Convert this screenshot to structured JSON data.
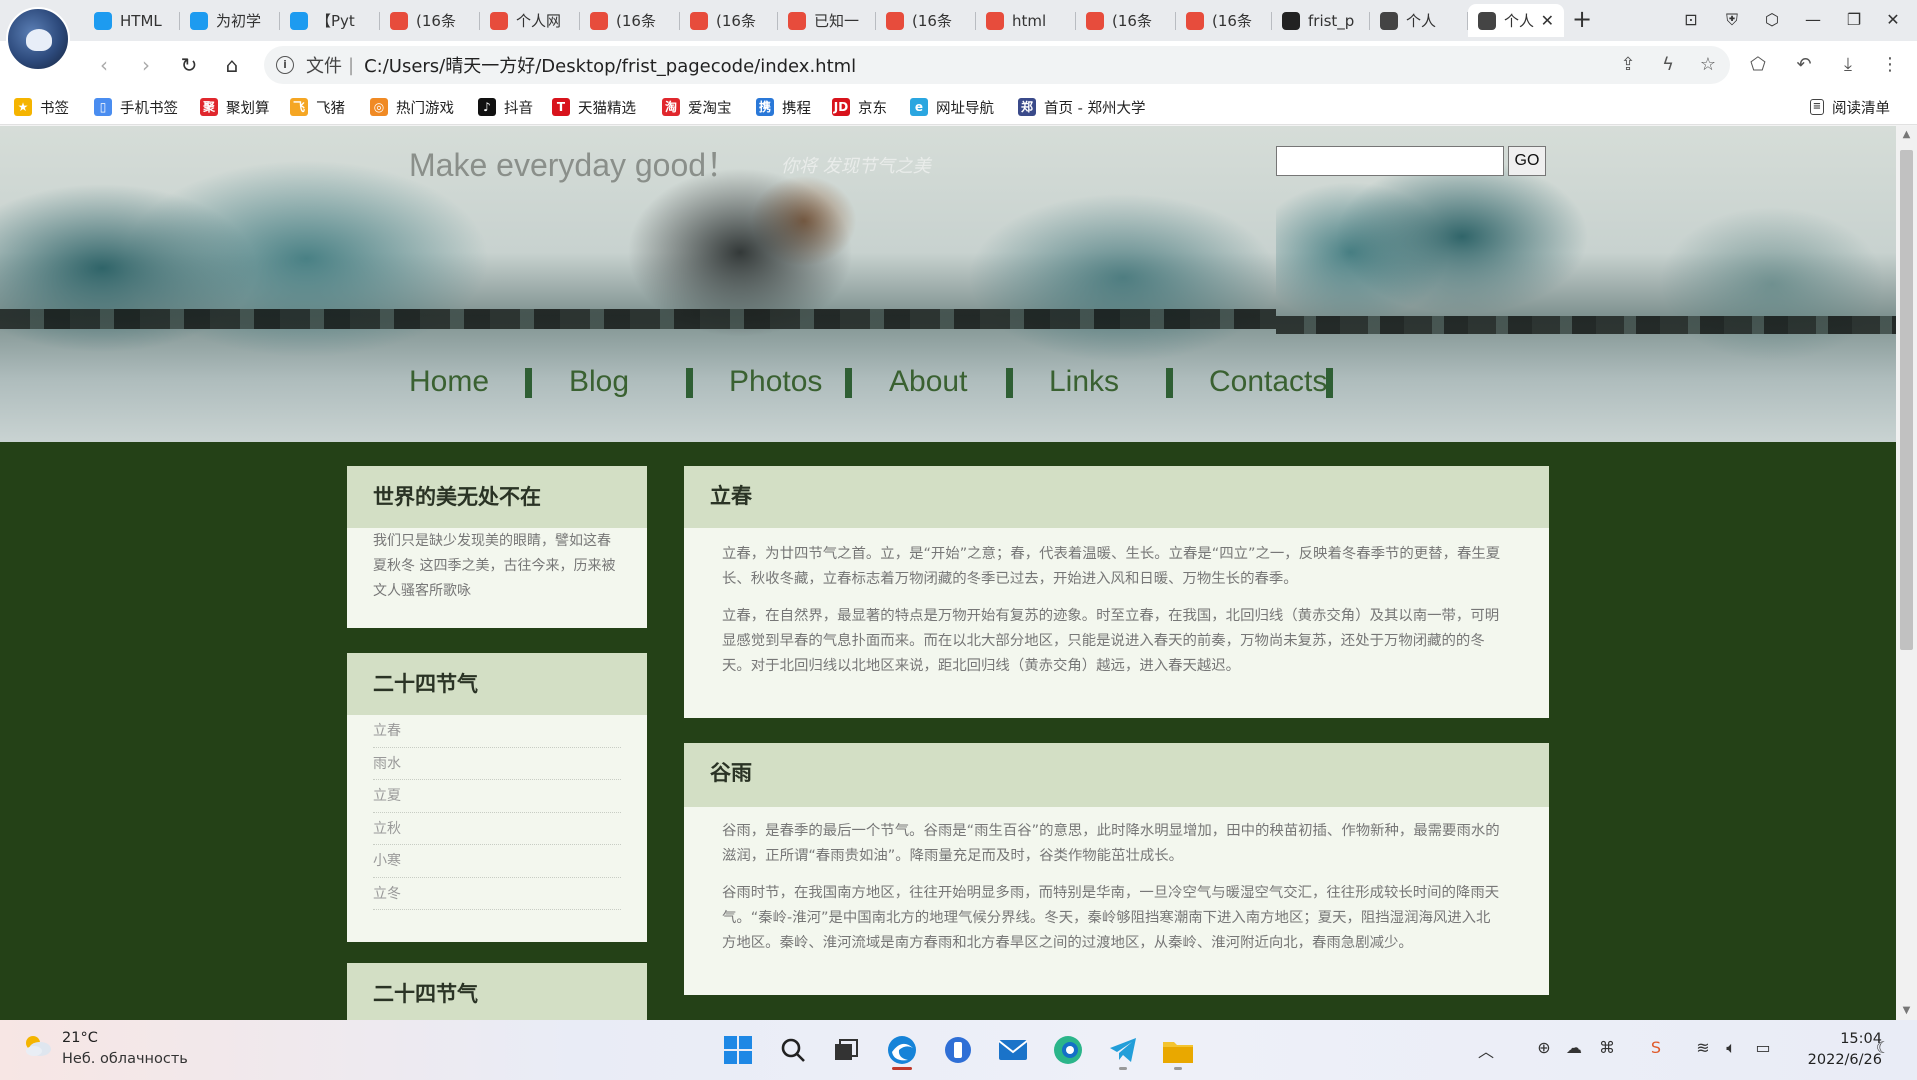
{
  "browser": {
    "tabs": [
      {
        "label": "HTML",
        "color": "#1d9bf0",
        "glyph": "tv"
      },
      {
        "label": "为初学",
        "color": "#1d9bf0",
        "glyph": "tv"
      },
      {
        "label": "【Pyt",
        "color": "#1d9bf0",
        "glyph": "tv"
      },
      {
        "label": "(16条",
        "color": "#e74c3c",
        "glyph": "C"
      },
      {
        "label": "个人网",
        "color": "#e74c3c",
        "glyph": "C"
      },
      {
        "label": "(16条",
        "color": "#e74c3c",
        "glyph": "C"
      },
      {
        "label": "(16条",
        "color": "#e74c3c",
        "glyph": "C"
      },
      {
        "label": "已知一",
        "color": "#e74c3c",
        "glyph": "C"
      },
      {
        "label": "(16条",
        "color": "#e74c3c",
        "glyph": "C"
      },
      {
        "label": "html",
        "color": "#e74c3c",
        "glyph": "C"
      },
      {
        "label": "(16条",
        "color": "#e74c3c",
        "glyph": "C"
      },
      {
        "label": "(16条",
        "color": "#e74c3c",
        "glyph": "C"
      },
      {
        "label": "frist_p",
        "color": "#222222",
        "glyph": "gh"
      },
      {
        "label": "个人",
        "color": "#444444",
        "glyph": "e"
      },
      {
        "label": "个人",
        "color": "#444444",
        "glyph": "e"
      }
    ],
    "url_scheme": "文件",
    "url": "C:/Users/晴天一方好/Desktop/frist_pagecode/index.html",
    "bookmarks": [
      {
        "label": "书签",
        "color": "#f5b400",
        "glyph": "★"
      },
      {
        "label": "手机书签",
        "color": "#4a8df0",
        "glyph": "▯"
      },
      {
        "label": "聚划算",
        "color": "#e0272d",
        "glyph": "聚"
      },
      {
        "label": "飞猪",
        "color": "#f5a623",
        "glyph": "飞"
      },
      {
        "label": "热门游戏",
        "color": "#f08a24",
        "glyph": "◎"
      },
      {
        "label": "抖音",
        "color": "#111111",
        "glyph": "♪"
      },
      {
        "label": "天猫精选",
        "color": "#d8131c",
        "glyph": "T"
      },
      {
        "label": "爱淘宝",
        "color": "#e0272d",
        "glyph": "淘"
      },
      {
        "label": "携程",
        "color": "#2a78d8",
        "glyph": "携"
      },
      {
        "label": "京东",
        "color": "#d8131c",
        "glyph": "JD"
      },
      {
        "label": "网址导航",
        "color": "#2aa6e0",
        "glyph": "e"
      },
      {
        "label": "首页 - 郑州大学",
        "color": "#3a4a8a",
        "glyph": "郑"
      }
    ],
    "reading_list": "阅读清单"
  },
  "page": {
    "slogan": "Make everyday good！",
    "subslogan": "你将 发现节气之美",
    "search_button": "GO",
    "nav": [
      "Home",
      "Blog",
      "Photos",
      "About",
      "Links",
      "Contacts"
    ],
    "sidebar": {
      "box1_title": "世界的美无处不在",
      "box1_text": "我们只是缺少发现美的眼睛，譬如这春夏秋冬 这四季之美，古往今来，历来被文人骚客所歌咏",
      "box2_title": "二十四节气",
      "box2_items": [
        "立春",
        "雨水",
        "立夏",
        "立秋",
        "小寒",
        "立冬"
      ],
      "box3_title": "二十四节气"
    },
    "articles": [
      {
        "title": "立春",
        "paragraphs": [
          "立春，为廿四节气之首。立，是“开始”之意；春，代表着温暖、生长。立春是“四立”之一，反映着冬春季节的更替，春生夏长、秋收冬藏，立春标志着万物闭藏的冬季已过去，开始进入风和日暖、万物生长的春季。",
          "立春，在自然界，最显著的特点是万物开始有复苏的迹象。时至立春，在我国，北回归线（黄赤交角）及其以南一带，可明显感觉到早春的气息扑面而来。而在以北大部分地区，只能是说进入春天的前奏，万物尚未复苏，还处于万物闭藏的的冬天。对于北回归线以北地区来说，距北回归线（黄赤交角）越远，进入春天越迟。"
        ]
      },
      {
        "title": "谷雨",
        "paragraphs": [
          "谷雨，是春季的最后一个节气。谷雨是“雨生百谷”的意思，此时降水明显增加，田中的秧苗初插、作物新种，最需要雨水的滋润，正所谓“春雨贵如油”。降雨量充足而及时，谷类作物能茁壮成长。",
          "谷雨时节，在我国南方地区，往往开始明显多雨，而特别是华南，一旦冷空气与暖湿空气交汇，往往形成较长时间的降雨天气。“秦岭-淮河”是中国南北方的地理气候分界线。冬天，秦岭够阻挡寒潮南下进入南方地区；夏天，阻挡湿润海风进入北方地区。秦岭、淮河流域是南方春雨和北方春旱区之间的过渡地区，从秦岭、淮河附近向北，春雨急剧减少。"
        ]
      }
    ]
  },
  "taskbar": {
    "weather_temp": "21°C",
    "weather_desc": "Неб. облачность",
    "time": "15:04",
    "date": "2022/6/26"
  }
}
